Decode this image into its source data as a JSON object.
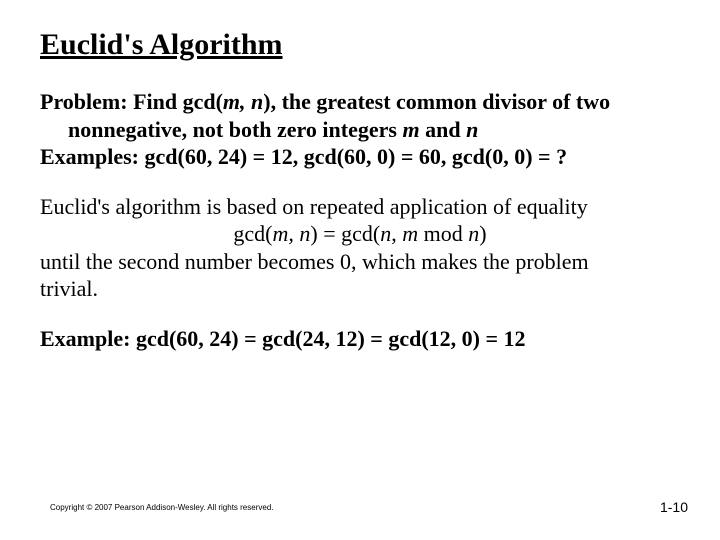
{
  "title": "Euclid's Algorithm",
  "problem": {
    "label": "Problem: Find gcd(",
    "mn1": "m, n",
    "after_mn": "), the greatest common divisor of two nonnegative, not both zero integers ",
    "m": "m",
    "and": " and ",
    "n": "n"
  },
  "examples_line": {
    "label": "Examples:  gcd(60, 24) = 12,    gcd(60, 0) = 60,    gcd(0, 0) = ?"
  },
  "desc1": "Euclid's algorithm is based on repeated application of equality",
  "formula": {
    "p1": "gcd(",
    "mn": "m, n",
    "p2": ") = gcd(",
    "n": "n",
    "comma": ", ",
    "m": "m",
    "mod": " mod ",
    "n2": "n",
    "p3": ")"
  },
  "desc2a": "until the second number becomes 0, which makes the problem",
  "desc2b": "trivial.",
  "example2": "Example: gcd(60, 24) = gcd(24, 12) = gcd(12, 0) = 12",
  "copyright": "Copyright © 2007 Pearson Addison-Wesley. All rights reserved.",
  "pagenum": "1-10"
}
